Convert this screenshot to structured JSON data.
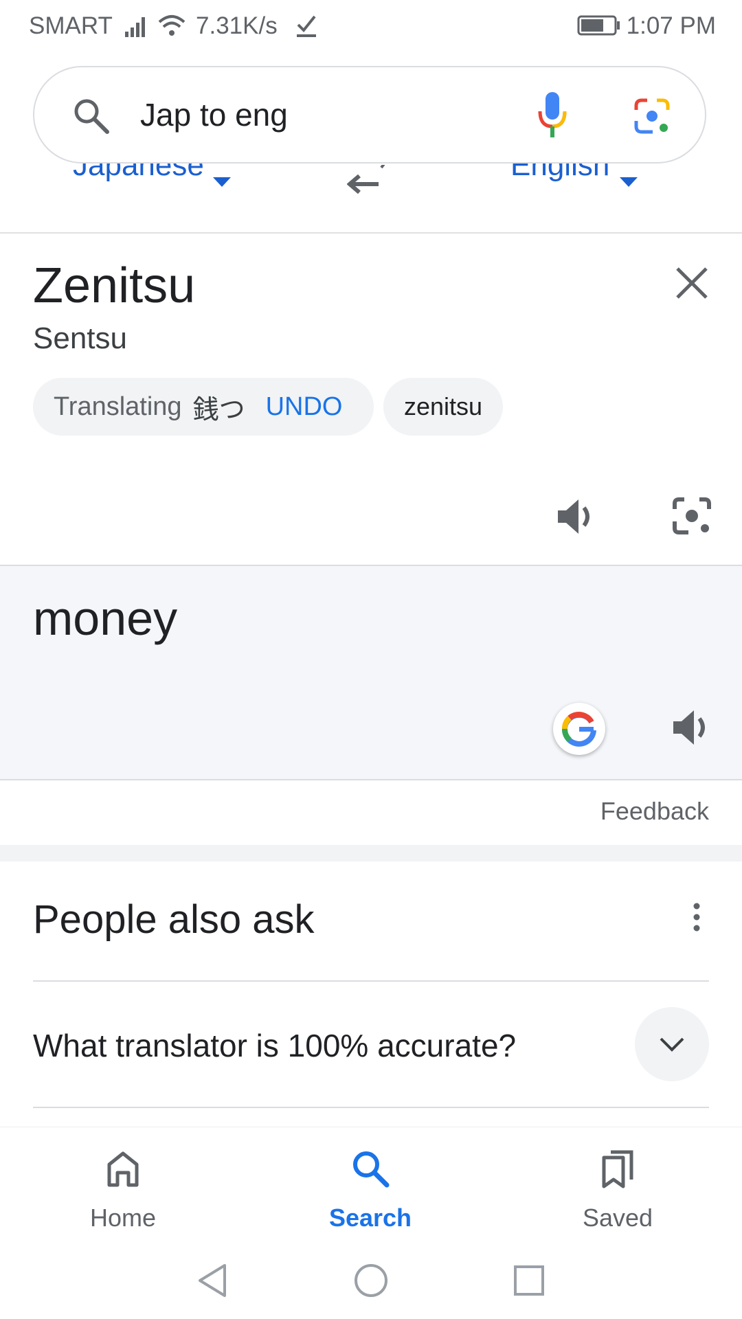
{
  "status_bar": {
    "carrier": "SMART",
    "net_speed": "7.31K/s",
    "time": "1:07 PM"
  },
  "search": {
    "query": "Jap to eng"
  },
  "translate": {
    "source_language": "Japanese",
    "target_language": "English",
    "source_text": "Zenitsu",
    "romanization": "Sentsu",
    "translating_label": "Translating",
    "translating_value": "銭つ",
    "undo_label": "UNDO",
    "alt_chip": "zenitsu",
    "target_text": "money",
    "feedback_label": "Feedback"
  },
  "people_also_ask": {
    "title": "People also ask",
    "questions": [
      "What translator is 100% accurate?"
    ]
  },
  "bottom_nav": {
    "items": [
      {
        "label": "Home",
        "icon": "home-icon",
        "active": false
      },
      {
        "label": "Search",
        "icon": "search-icon",
        "active": true
      },
      {
        "label": "Saved",
        "icon": "bookmarks-icon",
        "active": false
      }
    ]
  },
  "colors": {
    "accent": "#1a73e8",
    "link": "#1a5fd0",
    "panel": "#f4f6fa"
  }
}
